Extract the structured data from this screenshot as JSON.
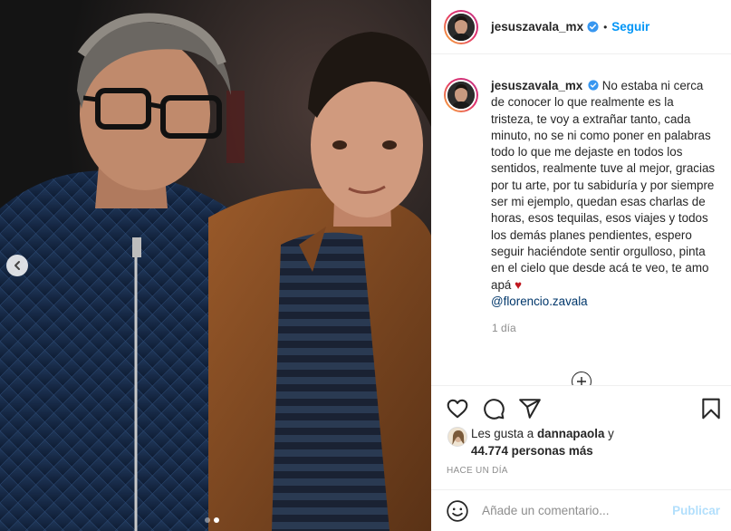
{
  "post": {
    "username": "jesuszavala_mx",
    "separator": "•",
    "follow_label": "Seguir",
    "caption_text": "No estaba ni cerca de conocer lo que realmente es la tristeza, te voy a extrañar tanto, cada minuto, no se ni como poner en palabras todo lo que me dejaste en todos los sentidos, realmente tuve al mejor, gracias por tu arte, por tu sabiduría y por siempre ser mi ejemplo, quedan esas charlas de horas, esos tequilas, esos viajes y todos los demás planes pendientes, espero seguir haciéndote sentir orgulloso, pinta en el cielo que desde acá te veo, te amo apá",
    "caption_heart": "♥",
    "mention": "@florencio.zavala",
    "caption_time": "1 día",
    "likes_prefix": "Les gusta a",
    "likes_user": "dannapaola",
    "likes_conjunction": "y",
    "likes_count": "44.774 personas más",
    "post_time": "HACE UN DÍA"
  },
  "comment_box": {
    "placeholder": "Añade un comentario...",
    "publish_label": "Publicar"
  },
  "carousel": {
    "slides": 2,
    "active_index": 1
  },
  "icons": {
    "verified": "verified-badge-icon",
    "like": "heart-icon",
    "comment": "comment-icon",
    "share": "paper-plane-icon",
    "save": "bookmark-icon",
    "emoji": "smiley-icon",
    "load_more": "plus-circle-icon",
    "prev": "chevron-left-icon"
  },
  "colors": {
    "link_blue": "#0095f6",
    "mention": "#00376b",
    "publish_disabled": "#b2dffc",
    "secondary_text": "#8e8e8e",
    "heart_red": "#c0181f"
  }
}
